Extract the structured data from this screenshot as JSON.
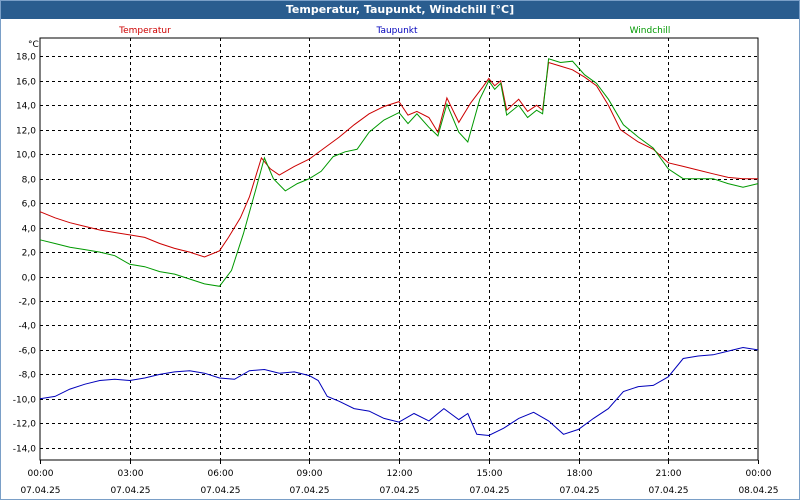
{
  "window": {
    "title": "Temperatur, Taupunkt, Windchill [°C]"
  },
  "chart_data": {
    "type": "line",
    "title": "Temperatur, Taupunkt, Windchill [°C]",
    "ylabel": "°C",
    "xlabel": "",
    "ylim": [
      -15,
      19.5
    ],
    "xlim": [
      0,
      24
    ],
    "grid": true,
    "legend_position": "top",
    "y_ticks": [
      {
        "value": 18,
        "label": "18,0"
      },
      {
        "value": 16,
        "label": "16,0"
      },
      {
        "value": 14,
        "label": "14,0"
      },
      {
        "value": 12,
        "label": "12,0"
      },
      {
        "value": 10,
        "label": "10,0"
      },
      {
        "value": 8,
        "label": "8,0"
      },
      {
        "value": 6,
        "label": "6,0"
      },
      {
        "value": 4,
        "label": "4,0"
      },
      {
        "value": 2,
        "label": "2,0"
      },
      {
        "value": 0,
        "label": "0,0"
      },
      {
        "value": -2,
        "label": "-2,0"
      },
      {
        "value": -4,
        "label": "-4,0"
      },
      {
        "value": -6,
        "label": "-6,0"
      },
      {
        "value": -8,
        "label": "-8,0"
      },
      {
        "value": -10,
        "label": "-10,0"
      },
      {
        "value": -12,
        "label": "-12,0"
      },
      {
        "value": -14,
        "label": "-14,0"
      }
    ],
    "x_ticks": [
      {
        "value": 0,
        "time": "00:00",
        "date": "07.04.25"
      },
      {
        "value": 3,
        "time": "03:00",
        "date": "07.04.25"
      },
      {
        "value": 6,
        "time": "06:00",
        "date": "07.04.25"
      },
      {
        "value": 9,
        "time": "09:00",
        "date": "07.04.25"
      },
      {
        "value": 12,
        "time": "12:00",
        "date": "07.04.25"
      },
      {
        "value": 15,
        "time": "15:00",
        "date": "07.04.25"
      },
      {
        "value": 18,
        "time": "18:00",
        "date": "07.04.25"
      },
      {
        "value": 21,
        "time": "21:00",
        "date": "07.04.25"
      },
      {
        "value": 24,
        "time": "00:00",
        "date": "08.04.25"
      }
    ],
    "series": [
      {
        "name": "Temperatur",
        "color": "#cc0000",
        "points": [
          [
            0,
            5.3
          ],
          [
            0.5,
            4.8
          ],
          [
            1,
            4.4
          ],
          [
            1.5,
            4.1
          ],
          [
            2,
            3.8
          ],
          [
            2.5,
            3.6
          ],
          [
            3,
            3.4
          ],
          [
            3.5,
            3.2
          ],
          [
            4,
            2.7
          ],
          [
            4.5,
            2.3
          ],
          [
            5,
            2.0
          ],
          [
            5.5,
            1.6
          ],
          [
            6,
            2.1
          ],
          [
            6.3,
            3.2
          ],
          [
            6.7,
            4.8
          ],
          [
            7,
            6.5
          ],
          [
            7.4,
            9.7
          ],
          [
            7.7,
            8.8
          ],
          [
            8,
            8.3
          ],
          [
            8.5,
            9.0
          ],
          [
            9,
            9.6
          ],
          [
            9.5,
            10.5
          ],
          [
            10,
            11.4
          ],
          [
            10.5,
            12.4
          ],
          [
            11,
            13.3
          ],
          [
            11.5,
            13.9
          ],
          [
            12,
            14.3
          ],
          [
            12.3,
            13.2
          ],
          [
            12.6,
            13.5
          ],
          [
            13,
            13.0
          ],
          [
            13.3,
            11.8
          ],
          [
            13.6,
            14.6
          ],
          [
            14,
            12.6
          ],
          [
            14.4,
            14.2
          ],
          [
            14.8,
            15.5
          ],
          [
            15,
            16.2
          ],
          [
            15.2,
            15.6
          ],
          [
            15.4,
            16.0
          ],
          [
            15.6,
            13.6
          ],
          [
            16,
            14.5
          ],
          [
            16.3,
            13.5
          ],
          [
            16.6,
            14.0
          ],
          [
            16.8,
            13.6
          ],
          [
            17,
            17.5
          ],
          [
            17.4,
            17.2
          ],
          [
            17.8,
            16.9
          ],
          [
            18.2,
            16.3
          ],
          [
            18.6,
            15.6
          ],
          [
            19,
            14.0
          ],
          [
            19.4,
            12.0
          ],
          [
            20,
            11.0
          ],
          [
            20.5,
            10.4
          ],
          [
            21,
            9.3
          ],
          [
            21.5,
            9.0
          ],
          [
            22,
            8.7
          ],
          [
            22.5,
            8.4
          ],
          [
            23,
            8.1
          ],
          [
            23.5,
            8.0
          ],
          [
            24,
            8.0
          ]
        ]
      },
      {
        "name": "Taupunkt",
        "color": "#0000bb",
        "points": [
          [
            0,
            -10.0
          ],
          [
            0.5,
            -9.8
          ],
          [
            1,
            -9.2
          ],
          [
            1.5,
            -8.8
          ],
          [
            2,
            -8.5
          ],
          [
            2.5,
            -8.4
          ],
          [
            3,
            -8.5
          ],
          [
            3.5,
            -8.3
          ],
          [
            4,
            -8.0
          ],
          [
            4.5,
            -7.8
          ],
          [
            5,
            -7.7
          ],
          [
            5.5,
            -7.9
          ],
          [
            6,
            -8.3
          ],
          [
            6.5,
            -8.4
          ],
          [
            7,
            -7.7
          ],
          [
            7.5,
            -7.6
          ],
          [
            8,
            -7.9
          ],
          [
            8.5,
            -7.8
          ],
          [
            9,
            -8.1
          ],
          [
            9.3,
            -8.5
          ],
          [
            9.6,
            -9.8
          ],
          [
            10,
            -10.2
          ],
          [
            10.5,
            -10.8
          ],
          [
            11,
            -11.0
          ],
          [
            11.5,
            -11.6
          ],
          [
            12,
            -11.9
          ],
          [
            12.5,
            -11.2
          ],
          [
            13,
            -11.8
          ],
          [
            13.5,
            -10.8
          ],
          [
            14,
            -11.7
          ],
          [
            14.3,
            -11.2
          ],
          [
            14.6,
            -12.9
          ],
          [
            15,
            -13.0
          ],
          [
            15.5,
            -12.4
          ],
          [
            16,
            -11.6
          ],
          [
            16.5,
            -11.1
          ],
          [
            17,
            -11.8
          ],
          [
            17.5,
            -12.9
          ],
          [
            18,
            -12.5
          ],
          [
            18.5,
            -11.6
          ],
          [
            19,
            -10.8
          ],
          [
            19.5,
            -9.4
          ],
          [
            20,
            -9.0
          ],
          [
            20.5,
            -8.9
          ],
          [
            21,
            -8.2
          ],
          [
            21.5,
            -6.7
          ],
          [
            22,
            -6.5
          ],
          [
            22.5,
            -6.4
          ],
          [
            23,
            -6.1
          ],
          [
            23.5,
            -5.8
          ],
          [
            24,
            -6.0
          ]
        ]
      },
      {
        "name": "Windchill",
        "color": "#009900",
        "points": [
          [
            0,
            3.0
          ],
          [
            0.5,
            2.7
          ],
          [
            1,
            2.4
          ],
          [
            1.5,
            2.2
          ],
          [
            2,
            2.0
          ],
          [
            2.5,
            1.7
          ],
          [
            3,
            1.0
          ],
          [
            3.5,
            0.8
          ],
          [
            4,
            0.4
          ],
          [
            4.5,
            0.2
          ],
          [
            5,
            -0.2
          ],
          [
            5.5,
            -0.6
          ],
          [
            6,
            -0.8
          ],
          [
            6.4,
            0.5
          ],
          [
            6.8,
            3.5
          ],
          [
            7.2,
            7.0
          ],
          [
            7.5,
            9.7
          ],
          [
            7.8,
            8.0
          ],
          [
            8.2,
            7.0
          ],
          [
            8.6,
            7.6
          ],
          [
            9,
            8.0
          ],
          [
            9.4,
            8.6
          ],
          [
            9.8,
            9.8
          ],
          [
            10.2,
            10.2
          ],
          [
            10.6,
            10.4
          ],
          [
            11,
            11.8
          ],
          [
            11.5,
            12.8
          ],
          [
            12,
            13.4
          ],
          [
            12.3,
            12.5
          ],
          [
            12.6,
            13.3
          ],
          [
            13,
            12.2
          ],
          [
            13.3,
            11.5
          ],
          [
            13.6,
            14.1
          ],
          [
            14,
            11.8
          ],
          [
            14.3,
            11.0
          ],
          [
            14.7,
            14.5
          ],
          [
            15,
            16.0
          ],
          [
            15.2,
            15.3
          ],
          [
            15.4,
            15.8
          ],
          [
            15.6,
            13.2
          ],
          [
            16,
            14.0
          ],
          [
            16.3,
            13.0
          ],
          [
            16.6,
            13.6
          ],
          [
            16.8,
            13.3
          ],
          [
            17,
            17.8
          ],
          [
            17.4,
            17.5
          ],
          [
            17.8,
            17.6
          ],
          [
            18.2,
            16.5
          ],
          [
            18.6,
            15.8
          ],
          [
            19,
            14.5
          ],
          [
            19.5,
            12.4
          ],
          [
            20,
            11.4
          ],
          [
            20.5,
            10.5
          ],
          [
            21,
            8.8
          ],
          [
            21.5,
            8.0
          ],
          [
            22,
            8.0
          ],
          [
            22.5,
            8.0
          ],
          [
            23,
            7.6
          ],
          [
            23.5,
            7.3
          ],
          [
            24,
            7.6
          ]
        ]
      }
    ]
  }
}
